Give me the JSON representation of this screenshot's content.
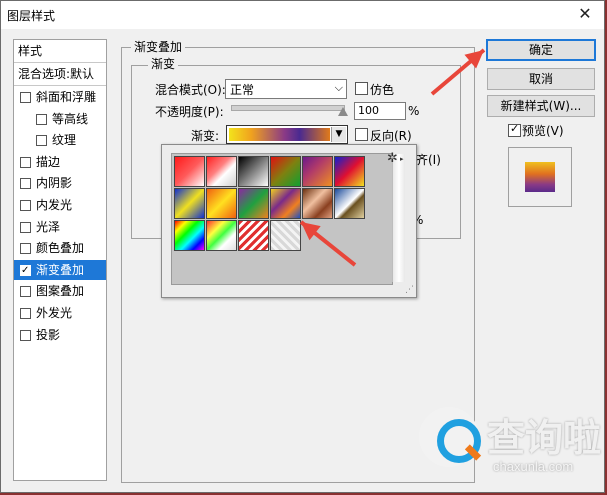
{
  "window": {
    "title": "图层样式",
    "close_label": "✕"
  },
  "sidebar": {
    "header": "样式",
    "blend_default": "混合选项:默认",
    "items": [
      {
        "label": "斜面和浮雕",
        "checked": false,
        "indent": false
      },
      {
        "label": "等高线",
        "checked": false,
        "indent": true
      },
      {
        "label": "纹理",
        "checked": false,
        "indent": true
      },
      {
        "label": "描边",
        "checked": false,
        "indent": false
      },
      {
        "label": "内阴影",
        "checked": false,
        "indent": false
      },
      {
        "label": "内发光",
        "checked": false,
        "indent": false
      },
      {
        "label": "光泽",
        "checked": false,
        "indent": false
      },
      {
        "label": "颜色叠加",
        "checked": false,
        "indent": false
      },
      {
        "label": "渐变叠加",
        "checked": true,
        "indent": false,
        "selected": true
      },
      {
        "label": "图案叠加",
        "checked": false,
        "indent": false
      },
      {
        "label": "外发光",
        "checked": false,
        "indent": false
      },
      {
        "label": "投影",
        "checked": false,
        "indent": false
      }
    ]
  },
  "panel": {
    "title": "渐变叠加",
    "group_title": "渐变",
    "blend_mode_label": "混合模式(O):",
    "blend_mode_value": "正常",
    "dither_label": "仿色",
    "opacity_label": "不透明度(P):",
    "opacity_value": "100",
    "percent_sign": "%",
    "gradient_label": "渐变:",
    "reverse_label": "反向(R)",
    "partial_align_label": "齐(I)",
    "partial_percent": "%",
    "dropdown_arrow": "▼",
    "select_arrow": "⌵"
  },
  "gradient_picker": {
    "settings_icon": "gear-icon",
    "swatches": [
      {
        "name": "foreground-to-background",
        "background": "linear-gradient(135deg,#ff1a1a 0%,#ff5a5a 50%,#ffffff 100%)"
      },
      {
        "name": "foreground-to-transparent",
        "background": "linear-gradient(135deg,#ff2020 0%,#ff8080 40%,#ffffff 60%,#d0d0d0 100%)"
      },
      {
        "name": "black-white",
        "background": "linear-gradient(135deg,#000000 0%,#808080 50%,#ffffff 100%)"
      },
      {
        "name": "red-green",
        "background": "linear-gradient(135deg,#e01010 0%,#808010 50%,#10a030 100%)"
      },
      {
        "name": "violet-orange",
        "background": "linear-gradient(135deg,#6a1a8a 0%,#b03a6a 40%,#f09020 100%)"
      },
      {
        "name": "blue-red-yellow",
        "background": "linear-gradient(135deg,#1020d0 0%,#e01030 50%,#f0e020 100%)"
      },
      {
        "name": "blue-yellow-blue",
        "background": "linear-gradient(135deg,#1030d0 0%,#f0e020 50%,#1030d0 100%)"
      },
      {
        "name": "orange-yellow-orange",
        "background": "linear-gradient(135deg,#f06010 0%,#ffe020 50%,#f06010 100%)"
      },
      {
        "name": "violet-green-orange",
        "background": "linear-gradient(135deg,#8a2aa0 0%,#20a040 50%,#f08020 100%)"
      },
      {
        "name": "yellow-violet-orange-blue",
        "background": "linear-gradient(135deg,#f0d020 0%,#7a2a8a 40%,#f08020 70%,#2050c0 100%)"
      },
      {
        "name": "copper",
        "background": "linear-gradient(135deg,#6a3010 0%,#f0c0a0 40%,#8a4020 70%,#e0a080 100%)"
      },
      {
        "name": "chrome",
        "background": "linear-gradient(135deg,#1a4a9a 0%,#ffffff 50%,#6a5020 60%,#e0d0a0 100%)"
      },
      {
        "name": "spectrum",
        "background": "linear-gradient(135deg,#ff0000 0%,#ffff00 20%,#00ff00 40%,#00ffff 60%,#0000ff 80%,#ff00ff 100%)"
      },
      {
        "name": "transparent-rainbow",
        "background": "linear-gradient(135deg,#ff3030 0%,#ffff40 30%,#40ff40 50%,#ffffff 70%,#e0e0e0 100%)"
      },
      {
        "name": "transparent-stripes",
        "background": "repeating-linear-gradient(135deg,#e03030 0px,#e03030 3px,#ffffff 3px,#ffffff 6px)"
      },
      {
        "name": "checker-transparent",
        "background": "repeating-linear-gradient(45deg,#d8d8d8 0px,#d8d8d8 3px,#f4f4f4 3px,#f4f4f4 6px)"
      }
    ]
  },
  "buttons": {
    "ok": "确定",
    "cancel": "取消",
    "new_style": "新建样式(W)...",
    "preview": "预览(V)"
  },
  "preview_checked": true,
  "watermark": {
    "cn": "查询啦",
    "en": "chaxunla.com"
  },
  "colors": {
    "accent": "#1e78d7",
    "annotation_arrow": "#e8463a",
    "background": "#f0f0f0"
  }
}
